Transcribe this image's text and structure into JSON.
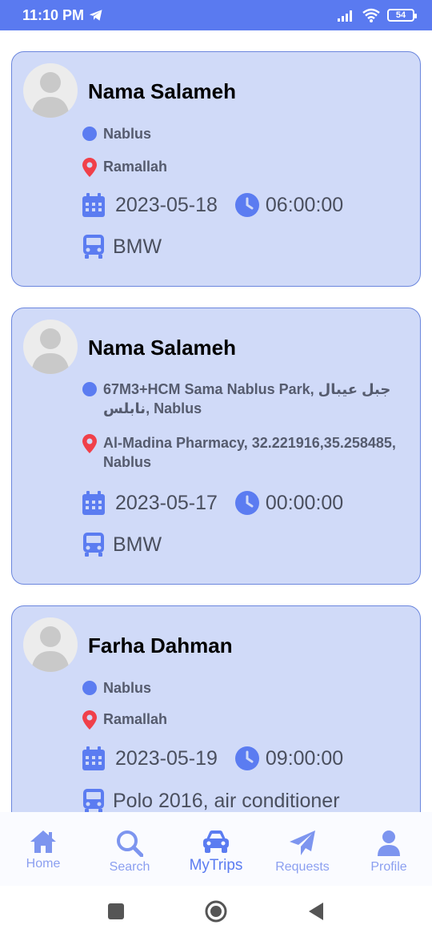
{
  "status_bar": {
    "time": "11:10 PM",
    "battery": "54"
  },
  "trips": [
    {
      "driver_name": "Nama Salameh",
      "from": "Nablus",
      "to": "Ramallah",
      "date": "2023-05-18",
      "time": "06:00:00",
      "car": "BMW"
    },
    {
      "driver_name": "Nama Salameh",
      "from": "67M3+HCM Sama Nablus Park, جبل عيبال نابلس, Nablus",
      "to": "Al-Madina Pharmacy, 32.221916,35.258485, Nablus",
      "date": "2023-05-17",
      "time": "00:00:00",
      "car": "BMW"
    },
    {
      "driver_name": "Farha Dahman",
      "from": "Nablus",
      "to": "Ramallah",
      "date": "2023-05-19",
      "time": "09:00:00",
      "car": "Polo 2016, air conditioner"
    }
  ],
  "bottom_nav": {
    "items": [
      {
        "label": "Home",
        "icon": "home-icon"
      },
      {
        "label": "Search",
        "icon": "search-icon"
      },
      {
        "label": "MyTrips",
        "icon": "car-icon"
      },
      {
        "label": "Requests",
        "icon": "send-icon"
      },
      {
        "label": "Profile",
        "icon": "person-icon"
      }
    ],
    "active": "MyTrips"
  },
  "colors": {
    "accent": "#5b7cf1",
    "card_bg": "#d0daf8",
    "card_border": "#6b86dd",
    "pin": "#f0404a"
  }
}
